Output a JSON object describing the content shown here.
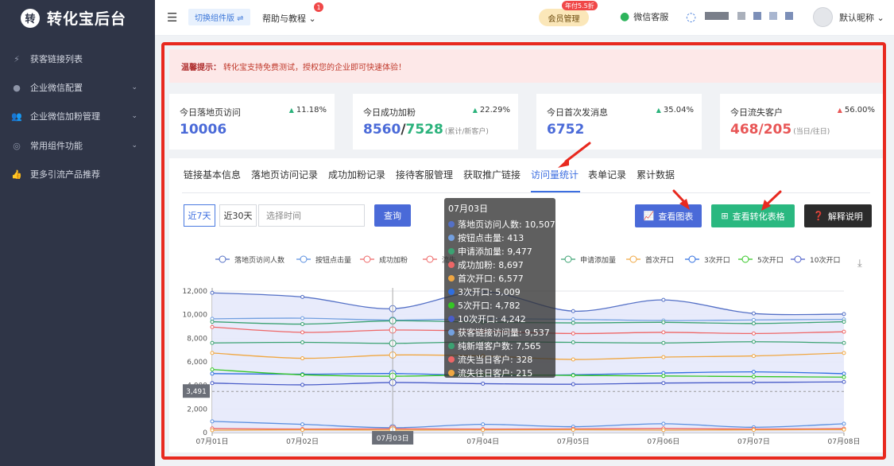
{
  "sidebar": {
    "logo_mark": "转",
    "logo_name": "转化宝后台",
    "items": [
      {
        "label": "获客链接列表",
        "icon": "flash-icon",
        "has_chevron": false
      },
      {
        "label": "企业微信配置",
        "icon": "chat-icon",
        "has_chevron": true
      },
      {
        "label": "企业微信加粉管理",
        "icon": "users-icon",
        "has_chevron": true
      },
      {
        "label": "常用组件功能",
        "icon": "component-icon",
        "has_chevron": true
      },
      {
        "label": "更多引流产品推荐",
        "icon": "thumbs-up-icon",
        "has_chevron": false
      }
    ]
  },
  "header": {
    "switch_label": "切换组件版 ⇌",
    "help_label": "帮助与教程",
    "help_badge": "1",
    "member_label": "会员管理",
    "promo_badge": "年付5.5折",
    "wechat_label": "微信客服",
    "nickname": "默认昵称"
  },
  "notice": {
    "title": "温馨提示：",
    "text": "转化宝支持免费测试，授权您的企业即可快速体验！"
  },
  "cards": [
    {
      "title": "今日落地页访问",
      "pct": "11.18%",
      "trend": "up",
      "value": "10006",
      "value2": "",
      "suffix": ""
    },
    {
      "title": "今日成功加粉",
      "pct": "22.29%",
      "trend": "up",
      "value": "8560",
      "value2": "7528",
      "suffix": "(累计/新客户)"
    },
    {
      "title": "今日首次发消息",
      "pct": "35.04%",
      "trend": "up",
      "value": "6752",
      "value2": "",
      "suffix": ""
    },
    {
      "title": "今日流失客户",
      "pct": "56.00%",
      "trend": "up",
      "value": "468/205",
      "value2": "",
      "suffix": "(当日/往日)"
    }
  ],
  "tabs": [
    "链接基本信息",
    "落地页访问记录",
    "成功加粉记录",
    "接待客服管理",
    "获取推广链接",
    "访问量统计",
    "表单记录",
    "累计数据"
  ],
  "active_tab": "访问量统计",
  "filters": {
    "range_7": "近7天",
    "range_30": "近30天",
    "date_placeholder": "选择时间",
    "query_label": "查询"
  },
  "actions": {
    "view_chart": "查看图表",
    "view_table": "查看转化表格",
    "explain": "解释说明"
  },
  "colors": {
    "accent": "#4a6ad8",
    "green_btn": "#2ab880",
    "dark_btn": "#2b2b2b",
    "red_frame": "#e8291f"
  },
  "chart_data": {
    "type": "line",
    "categories": [
      "07月01日",
      "07月02日",
      "07月03日",
      "07月04日",
      "07月05日",
      "07月06日",
      "07月07日",
      "07月08日"
    ],
    "ylim": [
      0,
      12000
    ],
    "yticks": [
      "0",
      "2,000",
      "4,000",
      "6,000",
      "8,000",
      "10,000",
      "12,000"
    ],
    "crosshair_y_label": "3,491",
    "crosshair_y_value": 3491,
    "crosshair_x_label": "07月03日",
    "legend": [
      "落地页访问人数",
      "按钮点击量",
      "成功加粉",
      "流失",
      "往日客户",
      "申请添加量",
      "首次开口",
      "3次开口",
      "5次开口",
      "10次开口"
    ],
    "series": [
      {
        "name": "落地页访问人数",
        "color": "#5470c6",
        "area": true,
        "values": [
          11850,
          11500,
          10507,
          11950,
          10300,
          11250,
          10100,
          10050
        ]
      },
      {
        "name": "获客链接访问量",
        "color": "#73a0e0",
        "area": false,
        "values": [
          9650,
          9700,
          9537,
          9650,
          9600,
          9500,
          9550,
          9600
        ]
      },
      {
        "name": "申请添加量",
        "color": "#3ba272",
        "area": false,
        "values": [
          9400,
          9200,
          9477,
          9350,
          9300,
          9350,
          9250,
          9400
        ]
      },
      {
        "name": "成功加粉",
        "color": "#ee6666",
        "area": false,
        "values": [
          8950,
          8500,
          8697,
          8600,
          8400,
          8500,
          8400,
          8550
        ]
      },
      {
        "name": "纯新增客户数",
        "color": "#3ba272",
        "area": false,
        "values": [
          7600,
          7650,
          7565,
          7700,
          7650,
          7600,
          7700,
          7600
        ]
      },
      {
        "name": "首次开口",
        "color": "#f0a742",
        "area": false,
        "values": [
          6750,
          6300,
          6577,
          6500,
          6200,
          6400,
          6500,
          6750
        ]
      },
      {
        "name": "3次开口",
        "color": "#2f6ee0",
        "area": false,
        "values": [
          5000,
          4950,
          5009,
          4850,
          4900,
          5050,
          5150,
          5000
        ]
      },
      {
        "name": "5次开口",
        "color": "#34c724",
        "area": false,
        "values": [
          5350,
          4900,
          4782,
          4900,
          4850,
          4800,
          4750,
          4700
        ]
      },
      {
        "name": "10次开口",
        "color": "#4a5dc8",
        "area": false,
        "values": [
          4200,
          4050,
          4242,
          4150,
          4100,
          4200,
          4250,
          4300
        ]
      },
      {
        "name": "按钮点击量",
        "color": "#5a8fe0",
        "area": false,
        "values": [
          950,
          700,
          413,
          700,
          500,
          750,
          450,
          750
        ]
      },
      {
        "name": "流失当日客户",
        "color": "#ee6666",
        "area": false,
        "values": [
          350,
          300,
          328,
          300,
          320,
          350,
          300,
          340
        ]
      },
      {
        "name": "流失往日客户",
        "color": "#f0a742",
        "area": false,
        "values": [
          200,
          230,
          215,
          220,
          240,
          210,
          230,
          250
        ]
      }
    ]
  },
  "tooltip": {
    "date": "07月03日",
    "rows": [
      {
        "label": "落地页访问人数: 10,507",
        "color": "#5470c6"
      },
      {
        "label": "按钮点击量: 413",
        "color": "#73a0e0"
      },
      {
        "label": "申请添加量: 9,477",
        "color": "#3ba272"
      },
      {
        "label": "成功加粉: 8,697",
        "color": "#ee6666"
      },
      {
        "label": "首次开口: 6,577",
        "color": "#f0a742"
      },
      {
        "label": "3次开口: 5,009",
        "color": "#2f6ee0"
      },
      {
        "label": "5次开口: 4,782",
        "color": "#34c724"
      },
      {
        "label": "10次开口: 4,242",
        "color": "#4a5dc8"
      },
      {
        "label": "获客链接访问量: 9,537",
        "color": "#73a0e0"
      },
      {
        "label": "纯新增客户数: 7,565",
        "color": "#3ba272"
      },
      {
        "label": "流失当日客户: 328",
        "color": "#ee6666"
      },
      {
        "label": "流失往日客户: 215",
        "color": "#f0a742"
      }
    ]
  }
}
